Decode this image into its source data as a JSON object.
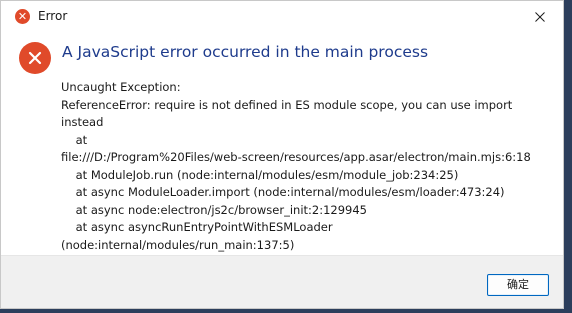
{
  "window": {
    "title": "Error",
    "close_icon": "close-icon",
    "error_icon": "error-icon"
  },
  "dialog": {
    "heading": "A JavaScript error occurred in the main process",
    "message": "Uncaught Exception:\nReferenceError: require is not defined in ES module scope, you can use import\ninstead\n    at\nfile:///D:/Program%20Files/web-screen/resources/app.asar/electron/main.mjs:6:18\n    at ModuleJob.run (node:internal/modules/esm/module_job:234:25)\n    at async ModuleLoader.import (node:internal/modules/esm/loader:473:24)\n    at async node:electron/js2c/browser_init:2:129945\n    at async asyncRunEntryPointWithESMLoader\n(node:internal/modules/run_main:137:5)",
    "ok_label": "确定"
  },
  "colors": {
    "error_red": "#e04a2a",
    "heading_blue": "#1e3b8c",
    "button_border": "#0067c0"
  }
}
